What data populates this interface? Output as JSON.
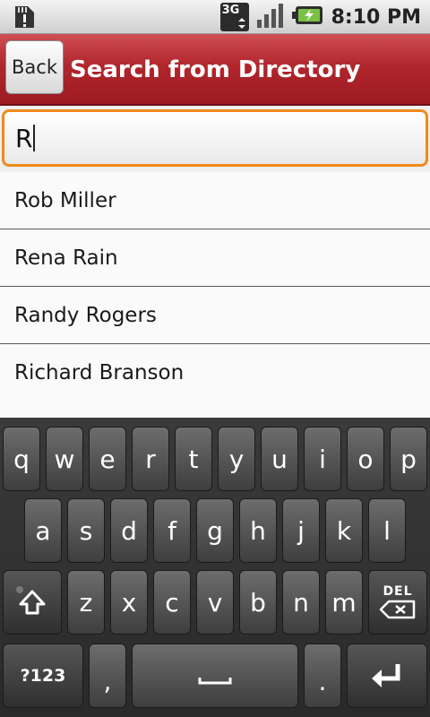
{
  "status_bar": {
    "time": "8:10 PM",
    "network_label": "3G"
  },
  "header": {
    "back_label": "Back",
    "title": "Search from Directory"
  },
  "search": {
    "value": "R"
  },
  "results": [
    "Rob Miller",
    "Rena Rain",
    "Randy Rogers",
    "Richard Branson"
  ],
  "keyboard": {
    "row1": [
      "q",
      "w",
      "e",
      "r",
      "t",
      "y",
      "u",
      "i",
      "o",
      "p"
    ],
    "row2": [
      "a",
      "s",
      "d",
      "f",
      "g",
      "h",
      "j",
      "k",
      "l"
    ],
    "row3": [
      "z",
      "x",
      "c",
      "v",
      "b",
      "n",
      "m"
    ],
    "symbols_label": "?123",
    "comma_label": ",",
    "period_label": ".",
    "delete_label": "DEL"
  },
  "colors": {
    "header_red": "#b2262d",
    "focus_orange": "#f08a1c",
    "keyboard_bg": "#2e2e2e"
  }
}
